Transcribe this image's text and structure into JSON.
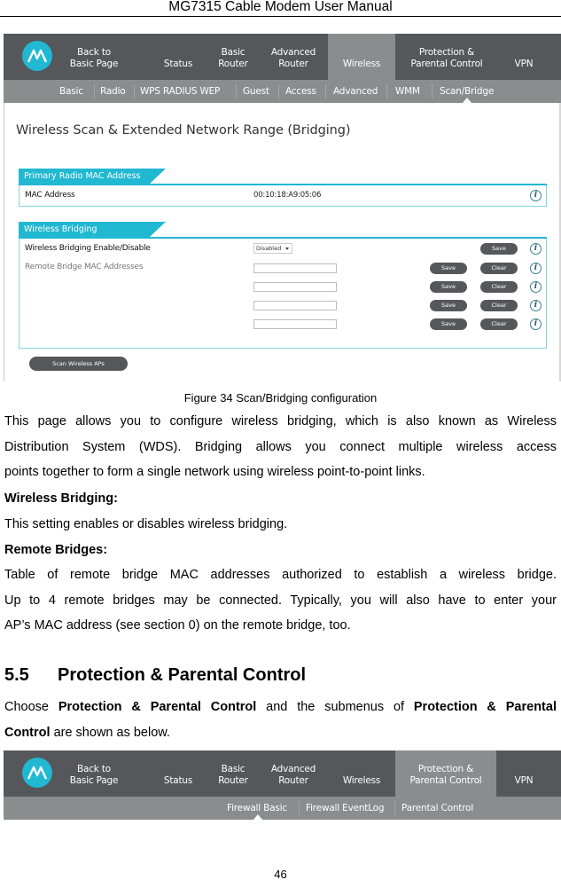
{
  "document": {
    "running_header": "MG7315 Cable Modem User Manual",
    "page_number": "46"
  },
  "router_ui": {
    "brand_icon": "motorola-logo-icon",
    "accent_color": "#21b8d2",
    "nav_dark_color": "#55575b",
    "nav_active_color": "#8a8c8e",
    "top_nav": [
      {
        "label": "Back to\nBasic Page",
        "l1": "Back to",
        "l2": "Basic Page"
      },
      {
        "label": "Status",
        "l1": "",
        "l2": "Status"
      },
      {
        "label": "Basic Router",
        "l1": "Basic",
        "l2": "Router"
      },
      {
        "label": "Advanced Router",
        "l1": "Advanced",
        "l2": "Router"
      },
      {
        "label": "Wireless",
        "l1": "",
        "l2": "Wireless"
      },
      {
        "label": "Protection & Parental Control",
        "l1": "Protection &",
        "l2": "Parental Control"
      },
      {
        "label": "VPN",
        "l1": "",
        "l2": "VPN"
      }
    ]
  },
  "figure1": {
    "active_top_nav": "Wireless",
    "sub_nav": [
      "Basic",
      "Radio",
      "WPS RADIUS WEP",
      "Guest",
      "Access",
      "Advanced",
      "WMM",
      "Scan/Bridge"
    ],
    "active_sub_nav": "Scan/Bridge",
    "page_heading": "Wireless Scan & Extended Network Range (Bridging)",
    "primary_radio": {
      "title": "Primary Radio MAC Address",
      "mac_label": "MAC Address",
      "mac_value": "00:10:18:A9:05:06"
    },
    "bridging": {
      "title": "Wireless Bridging",
      "enable_label": "Wireless Bridging Enable/Disable",
      "enable_value": "Disabled",
      "save_label": "Save",
      "remote_label": "Remote Bridge MAC Addresses",
      "remote_entries": [
        {
          "value": "",
          "save": "Save",
          "clear": "Clear"
        },
        {
          "value": "",
          "save": "Save",
          "clear": "Clear"
        },
        {
          "value": "",
          "save": "Save",
          "clear": "Clear"
        },
        {
          "value": "",
          "save": "Save",
          "clear": "Clear"
        }
      ]
    },
    "scan_button": "Scan Wireless APs",
    "caption": "Figure 34 Scan/Bridging configuration"
  },
  "body": {
    "intro_line1": "This page allows you to configure wireless bridging, which is also known as Wireless",
    "intro_line2": "Distribution System (WDS). Bridging allows you connect multiple wireless access",
    "intro_line3": "points together to form a single network using wireless point-to-point links.",
    "wb_heading": "Wireless Bridging:",
    "wb_text": "This setting enables or disables wireless bridging.",
    "rb_heading": "Remote Bridges:",
    "rb_line1": "Table of remote bridge MAC addresses authorized to establish a wireless bridge.",
    "rb_line2": "Up to 4 remote bridges may be connected. Typically, you will also have to enter your",
    "rb_line3": "AP’s MAC address (see section 0) on the remote bridge, too."
  },
  "section": {
    "number": "5.5",
    "title": "Protection & Parental Control",
    "p_choose": "Choose ",
    "p_bold1": "Protection & Parental Control",
    "p_mid": " and the submenus of ",
    "p_bold2": "Protection & Parental",
    "p_bold3": "Control",
    "p_end": " are shown as below."
  },
  "figure2": {
    "active_top_nav": "Protection & Parental Control",
    "sub_nav": [
      "Firewall Basic",
      "Firewall EventLog",
      "Parental Control"
    ],
    "active_sub_nav": "Firewall Basic"
  }
}
